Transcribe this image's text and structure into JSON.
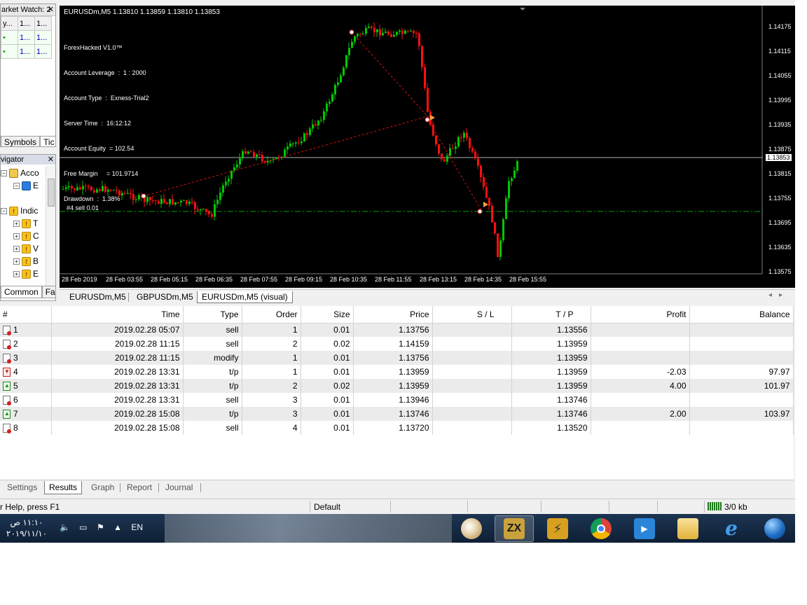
{
  "market_watch": {
    "title": "arket Watch: 2",
    "header_cells": [
      "y...",
      "1...",
      "1..."
    ],
    "rows": [
      [
        "•",
        "1...",
        "1...",
        "1..."
      ],
      [
        "•",
        "1...",
        "1...",
        "1..."
      ]
    ],
    "tabs": [
      "Symbols",
      "Tic"
    ]
  },
  "navigator": {
    "title": "vigator",
    "items": [
      "Acco",
      "E",
      "Indic",
      "T",
      "C",
      "V",
      "B",
      "E"
    ],
    "tabs": [
      "Common",
      "Fa"
    ]
  },
  "chart": {
    "title": "EURUSDm,M5  1.13810 1.13859 1.13810 1.13853",
    "info_lines": [
      "ForexHacked V1.0™",
      "Account Leverage  :  1 : 2000",
      "Account Type  :  Exness-Trial2",
      "Server Time  :  16:12:12",
      "Account Equity  = 102.54",
      "Free Margin     = 101.9714",
      "Drawdown  :  1.38%"
    ],
    "order_label": "#4 sell 0.01",
    "current_price": "1.13853",
    "y_ticks": [
      "1.14175",
      "1.14115",
      "1.14055",
      "1.13995",
      "1.13935",
      "1.13875",
      "1.13815",
      "1.13755",
      "1.13695",
      "1.13635",
      "1.13575"
    ],
    "x_ticks": [
      "28 Feb 2019",
      "28 Feb 03:55",
      "28 Feb 05:15",
      "28 Feb 06:35",
      "28 Feb 07:55",
      "28 Feb 09:15",
      "28 Feb 10:35",
      "28 Feb 11:55",
      "28 Feb 13:15",
      "28 Feb 14:35",
      "28 Feb 15:55"
    ],
    "colors": {
      "bull": "#00c800",
      "bear": "#ff1010",
      "background": "#000000",
      "level_line": "#00a000",
      "trade_line": "#e01010"
    }
  },
  "chart_tabs": [
    "EURUSDm,M5",
    "GBPUSDm,M5",
    "EURUSDm,M5 (visual)"
  ],
  "results": {
    "columns": [
      "#",
      "Time",
      "Type",
      "Order",
      "Size",
      "Price",
      "S / L",
      "T / P",
      "Profit",
      "Balance"
    ],
    "rows": [
      {
        "icon": "sell",
        "n": "1",
        "time": "2019.02.28 05:07",
        "type": "sell",
        "order": "1",
        "size": "0.01",
        "price": "1.13756",
        "sl": "",
        "tp": "1.13556",
        "profit": "",
        "balance": ""
      },
      {
        "icon": "sell",
        "n": "2",
        "time": "2019.02.28 11:15",
        "type": "sell",
        "order": "2",
        "size": "0.02",
        "price": "1.14159",
        "sl": "",
        "tp": "1.13959",
        "profit": "",
        "balance": ""
      },
      {
        "icon": "sell",
        "n": "3",
        "time": "2019.02.28 11:15",
        "type": "modify",
        "order": "1",
        "size": "0.01",
        "price": "1.13756",
        "sl": "",
        "tp": "1.13959",
        "profit": "",
        "balance": ""
      },
      {
        "icon": "tpdown",
        "n": "4",
        "time": "2019.02.28 13:31",
        "type": "t/p",
        "order": "1",
        "size": "0.01",
        "price": "1.13959",
        "sl": "",
        "tp": "1.13959",
        "profit": "-2.03",
        "balance": "97.97"
      },
      {
        "icon": "tpup",
        "n": "5",
        "time": "2019.02.28 13:31",
        "type": "t/p",
        "order": "2",
        "size": "0.02",
        "price": "1.13959",
        "sl": "",
        "tp": "1.13959",
        "profit": "4.00",
        "balance": "101.97"
      },
      {
        "icon": "sell",
        "n": "6",
        "time": "2019.02.28 13:31",
        "type": "sell",
        "order": "3",
        "size": "0.01",
        "price": "1.13946",
        "sl": "",
        "tp": "1.13746",
        "profit": "",
        "balance": ""
      },
      {
        "icon": "tpup",
        "n": "7",
        "time": "2019.02.28 15:08",
        "type": "t/p",
        "order": "3",
        "size": "0.01",
        "price": "1.13746",
        "sl": "",
        "tp": "1.13746",
        "profit": "2.00",
        "balance": "103.97"
      },
      {
        "icon": "sell",
        "n": "8",
        "time": "2019.02.28 15:08",
        "type": "sell",
        "order": "4",
        "size": "0.01",
        "price": "1.13720",
        "sl": "",
        "tp": "1.13520",
        "profit": "",
        "balance": ""
      }
    ]
  },
  "bottom_tabs": [
    "Settings",
    "Results",
    "Graph",
    "Report",
    "Journal"
  ],
  "status": {
    "help": "r Help, press F1",
    "profile": "Default",
    "traffic": "3/0 kb"
  },
  "taskbar": {
    "time": "١١:١٠ ص",
    "date": "٢٠١٩/١١/١٠",
    "lang": "EN"
  }
}
